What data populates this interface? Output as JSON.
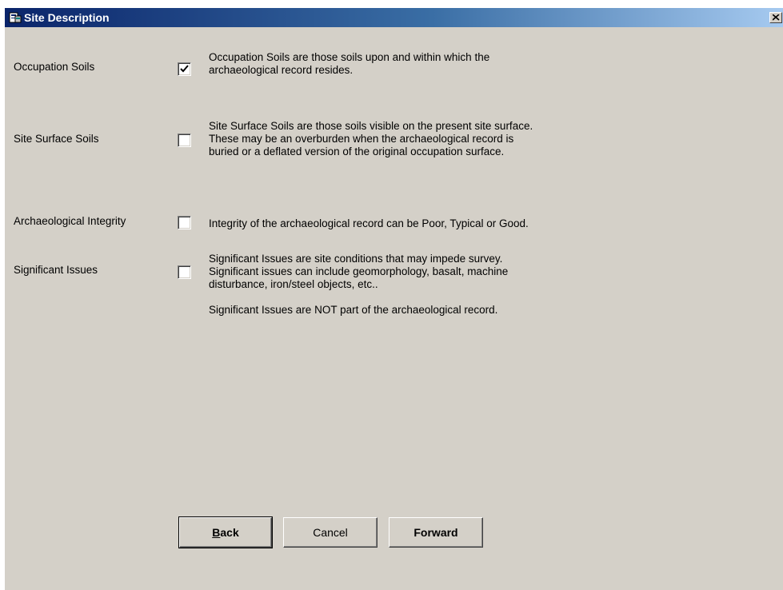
{
  "window": {
    "title": "Site Description",
    "close_label": "×"
  },
  "rows": [
    {
      "label": "Occupation Soils",
      "checked": true,
      "lines": [
        "Occupation Soils are those soils upon and within which the",
        "archaeological record resides."
      ]
    },
    {
      "label": "Site Surface Soils",
      "checked": false,
      "lines": [
        "Site Surface Soils are those soils visible on the present site surface.",
        "These may be an overburden when the archaeological record is",
        "buried or a deflated version of the original occupation surface."
      ]
    },
    {
      "label": "Archaeological Integrity",
      "checked": false,
      "lines": [
        "Integrity of the archaeological record can be Poor, Typical or Good."
      ]
    },
    {
      "label": "Significant Issues",
      "checked": false,
      "lines": [
        "Significant Issues are  site conditions that may impede survey.",
        "Significant issues can include geomorphology, basalt, machine",
        "disturbance, iron/steel objects, etc..",
        "",
        "Significant Issues are NOT part of the archaeological record."
      ]
    }
  ],
  "buttons": {
    "back_mnemonic": "B",
    "back_rest": "ack",
    "cancel": "Cancel",
    "forward": "Forward"
  }
}
